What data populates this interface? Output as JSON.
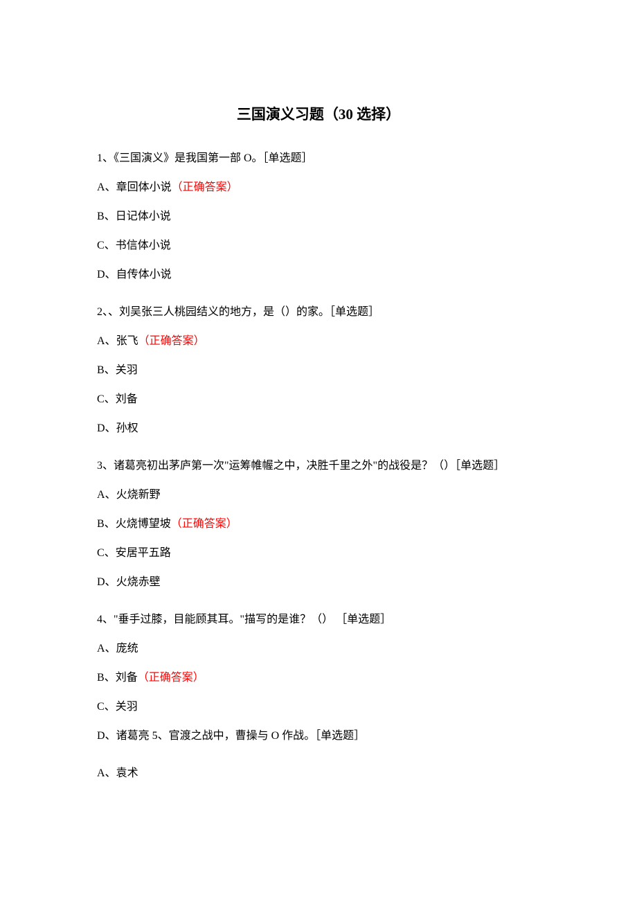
{
  "title": "三国演义习题（30 选择）",
  "questions": [
    {
      "stem": "1、《三国演义》是我国第一部 O。［单选题］",
      "options": [
        {
          "prefix": "A、",
          "text": "章回体小说",
          "correct": true,
          "marker": "（正确答案）"
        },
        {
          "prefix": "B、",
          "text": "日记体小说",
          "correct": false
        },
        {
          "prefix": "C、",
          "text": "书信体小说",
          "correct": false
        },
        {
          "prefix": "D、",
          "text": "自传体小说",
          "correct": false
        }
      ]
    },
    {
      "stem": "2、、刘吴张三人桃园结义的地方，是（）的家。［单选题］",
      "options": [
        {
          "prefix": "A、",
          "text": "张飞",
          "correct": true,
          "marker": "（正确答案）"
        },
        {
          "prefix": "B、",
          "text": "关羽",
          "correct": false
        },
        {
          "prefix": "C、",
          "text": "刘备",
          "correct": false
        },
        {
          "prefix": "D、",
          "text": "孙权",
          "correct": false
        }
      ]
    },
    {
      "stem": "3、诸葛亮初出茅庐第一次\"运筹帷幄之中，决胜千里之外\"的战役是？（）［单选题］",
      "options": [
        {
          "prefix": "A、",
          "text": "火烧新野",
          "correct": false
        },
        {
          "prefix": "B、",
          "text": "火烧博望坡",
          "correct": true,
          "marker": "（正确答案）"
        },
        {
          "prefix": "C、",
          "text": "安居平五路",
          "correct": false
        },
        {
          "prefix": "D、",
          "text": "火烧赤壁",
          "correct": false
        }
      ]
    },
    {
      "stem": "4、\"垂手过膝，目能顾其耳。\"描写的是谁？（） ［单选题］",
      "options": [
        {
          "prefix": "A、",
          "text": "庞统",
          "correct": false
        },
        {
          "prefix": "B、",
          "text": "刘备",
          "correct": true,
          "marker": "（正确答案）"
        },
        {
          "prefix": "C、",
          "text": "关羽",
          "correct": false
        },
        {
          "prefix": "D、",
          "text": "诸葛亮 5、官渡之战中，曹操与 O 作战。［单选题］",
          "correct": false
        }
      ]
    }
  ],
  "trailing_option": {
    "prefix": "A、",
    "text": "袁术"
  }
}
